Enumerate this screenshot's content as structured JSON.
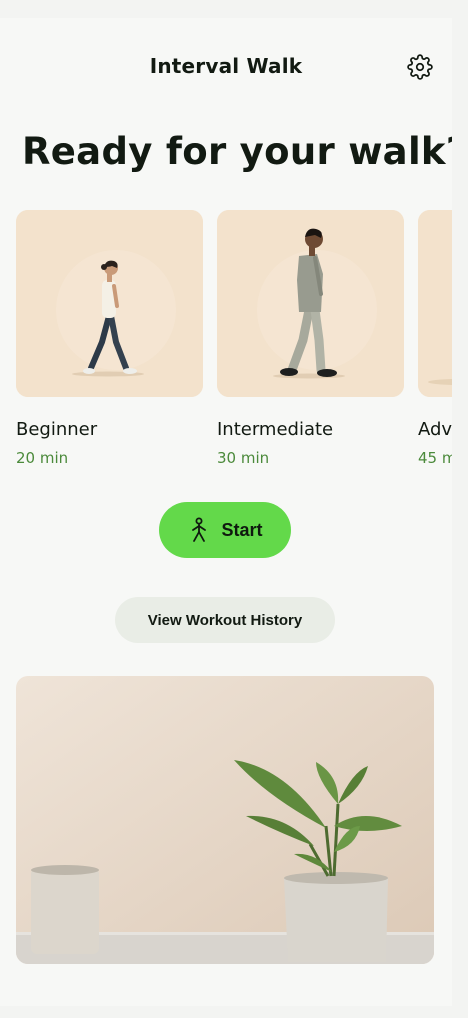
{
  "header": {
    "title": "Interval Walk",
    "settings_icon": "gear-icon"
  },
  "hero": {
    "title": "Ready for your walk?"
  },
  "workouts": [
    {
      "title": "Beginner",
      "duration": "20 min"
    },
    {
      "title": "Intermediate",
      "duration": "30 min"
    },
    {
      "title": "Adv",
      "duration": "45 m"
    }
  ],
  "actions": {
    "start_label": "Start",
    "start_icon": "walking-person-icon",
    "history_label": "View Workout History"
  },
  "colors": {
    "accent": "#63d94a",
    "duration_text": "#4b8a3b",
    "card_bg": "#f3e2cc"
  }
}
